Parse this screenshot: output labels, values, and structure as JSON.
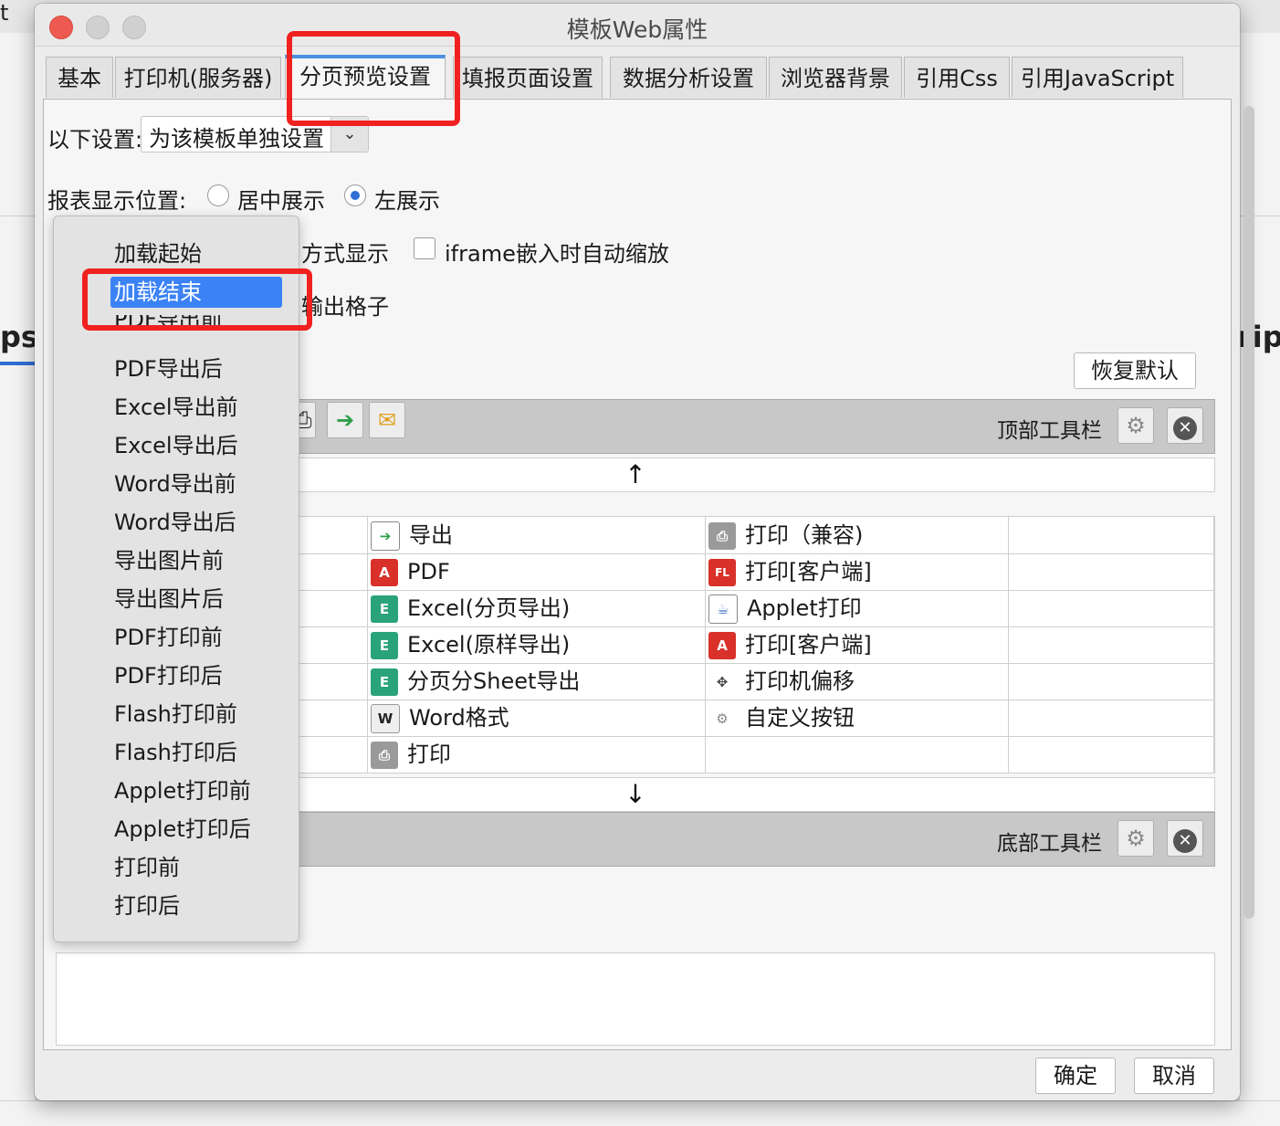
{
  "window": {
    "title": "模板Web属性"
  },
  "tabs": [
    {
      "label": "基本"
    },
    {
      "label": "打印机(服务器)"
    },
    {
      "label": "分页预览设置"
    },
    {
      "label": "填报页面设置"
    },
    {
      "label": "数据分析设置"
    },
    {
      "label": "浏览器背景"
    },
    {
      "label": "引用Css"
    },
    {
      "label": "引用JavaScript"
    }
  ],
  "settings": {
    "scope_label": "以下设置:",
    "scope_value": "为该模板单独设置",
    "position_label": "报表显示位置:",
    "position_options": [
      "居中展示",
      "左展示"
    ],
    "position_selected": "左展示",
    "display_mode_suffix": "方式显示",
    "iframe_checkbox_label": "iframe嵌入时自动缩放",
    "iframe_checked": false,
    "output_cell_suffix": "输出格子",
    "restore_default_button": "恢复默认"
  },
  "top_toolbar": {
    "label": "顶部工具栏"
  },
  "bottom_toolbar": {
    "label": "底部工具栏"
  },
  "button_grid": {
    "columns": [
      [
        "导出",
        "PDF",
        "Excel(分页导出)",
        "Excel(原样导出)",
        "分页分Sheet导出",
        "Word格式",
        "打印"
      ],
      [
        "打印（兼容)",
        "打印[客户端]",
        "Applet打印",
        "打印[客户端]",
        "打印机偏移",
        "自定义按钮"
      ]
    ]
  },
  "event_menu": {
    "items": [
      "加载起始",
      "加载结束",
      "PDF导出前",
      "PDF导出后",
      "Excel导出前",
      "Excel导出后",
      "Word导出前",
      "Word导出后",
      "导出图片前",
      "导出图片后",
      "PDF打印前",
      "PDF打印后",
      "Flash打印前",
      "Flash打印后",
      "Applet打印前",
      "Applet打印后",
      "打印前",
      "打印后"
    ],
    "selected": "加载结束"
  },
  "footer": {
    "ok": "确定",
    "cancel": "取消"
  },
  "background": {
    "fragment_left": "ps:",
    "fragment_right": "ript",
    "fragment_top": "t"
  },
  "colors": {
    "accent": "#3b82f6",
    "annotation": "#f0211f"
  }
}
